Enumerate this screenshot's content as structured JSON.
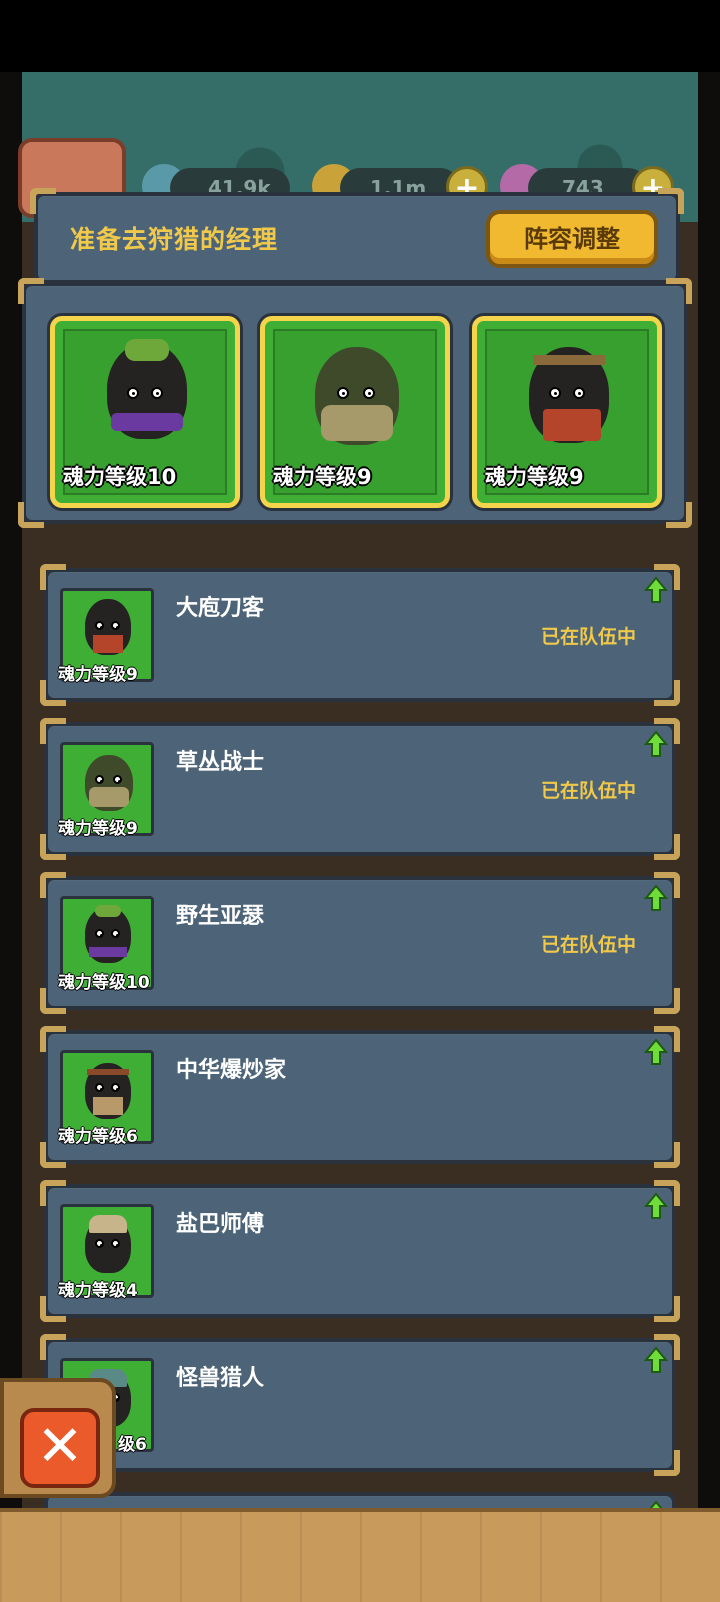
{
  "resources": {
    "soul": "41.9k",
    "coin": "1.1m",
    "potion": "743"
  },
  "header": {
    "title": "准备去狩猎的经理",
    "adjust_button": "阵容调整"
  },
  "selected": [
    {
      "level": "魂力等级10"
    },
    {
      "level": "魂力等级9"
    },
    {
      "level": "魂力等级9"
    }
  ],
  "roster": [
    {
      "name": "大庖刀客",
      "level": "魂力等级9",
      "status": "已在队伍中"
    },
    {
      "name": "草丛战士",
      "level": "魂力等级9",
      "status": "已在队伍中"
    },
    {
      "name": "野生亚瑟",
      "level": "魂力等级10",
      "status": "已在队伍中"
    },
    {
      "name": "中华爆炒家",
      "level": "魂力等级6",
      "status": ""
    },
    {
      "name": "盐巴师傅",
      "level": "魂力等级4",
      "status": ""
    },
    {
      "name": "怪兽猎人",
      "level": "级6",
      "status": ""
    }
  ],
  "close_glyph": "✕",
  "plus_glyph": "+"
}
